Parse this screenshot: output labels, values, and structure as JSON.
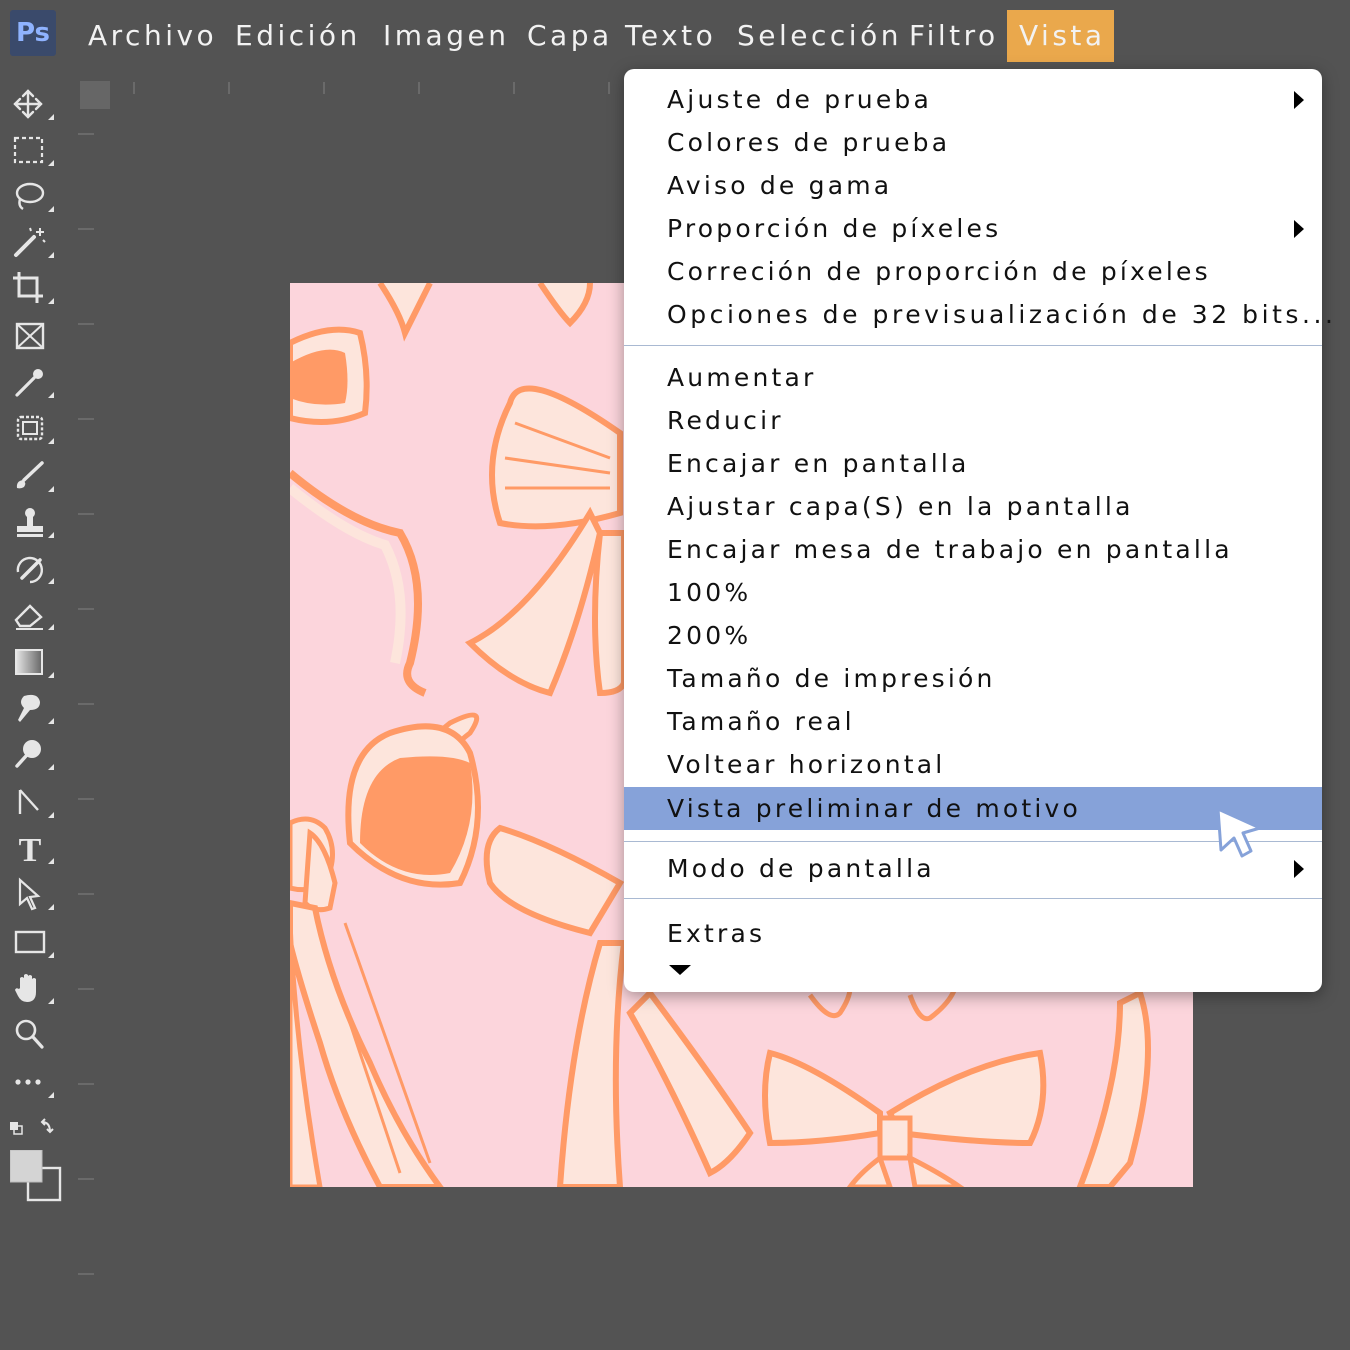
{
  "app": {
    "logo_text": "Ps"
  },
  "menubar": {
    "items": [
      {
        "label": "Archivo"
      },
      {
        "label": "Edición"
      },
      {
        "label": "Imagen"
      },
      {
        "label": "Capa"
      },
      {
        "label": "Texto"
      },
      {
        "label": "Selección"
      },
      {
        "label": "Filtro"
      },
      {
        "label": "Vista"
      }
    ],
    "active_item": "Vista",
    "active_color": "#eaa84c"
  },
  "toolbar": {
    "tools": [
      {
        "icon": "move-icon"
      },
      {
        "icon": "marquee-icon"
      },
      {
        "icon": "lasso-icon"
      },
      {
        "icon": "magic-wand-icon"
      },
      {
        "icon": "crop-icon"
      },
      {
        "icon": "frame-icon"
      },
      {
        "icon": "eyedropper-icon"
      },
      {
        "icon": "spot-healing-icon"
      },
      {
        "icon": "brush-icon"
      },
      {
        "icon": "stamp-icon"
      },
      {
        "icon": "history-brush-icon"
      },
      {
        "icon": "eraser-icon"
      },
      {
        "icon": "gradient-icon"
      },
      {
        "icon": "smudge-icon"
      },
      {
        "icon": "dodge-icon"
      },
      {
        "icon": "pen-icon"
      },
      {
        "icon": "type-icon"
      },
      {
        "icon": "path-selection-icon"
      },
      {
        "icon": "rectangle-icon"
      },
      {
        "icon": "hand-icon"
      },
      {
        "icon": "zoom-icon"
      },
      {
        "icon": "more-tools-icon"
      }
    ]
  },
  "dropdown": {
    "group1": [
      {
        "label": "Ajuste de prueba",
        "submenu": true
      },
      {
        "label": "Colores de prueba",
        "submenu": false
      },
      {
        "label": "Aviso de gama",
        "submenu": false
      },
      {
        "label": "Proporción de píxeles",
        "submenu": true
      },
      {
        "label": "Correción de proporción de píxeles",
        "submenu": false
      },
      {
        "label": "Opciones de previsualización de 32 bits...",
        "submenu": false
      }
    ],
    "group2": [
      {
        "label": "Aumentar"
      },
      {
        "label": "Reducir"
      },
      {
        "label": "Encajar en pantalla"
      },
      {
        "label": "Ajustar capa(S) en la pantalla"
      },
      {
        "label": "Encajar mesa de trabajo en pantalla"
      },
      {
        "label": "100%"
      },
      {
        "label": "200%"
      },
      {
        "label": "Tamaño de impresión"
      },
      {
        "label": "Tamaño real"
      },
      {
        "label": "Voltear horizontal"
      },
      {
        "label": "Vista preliminar de motivo",
        "highlighted": true
      }
    ],
    "group3": [
      {
        "label": "Modo de pantalla",
        "submenu": true
      }
    ],
    "group4": [
      {
        "label": "Extras"
      }
    ],
    "highlight_color": "#86a2d9"
  },
  "document": {
    "background_color": "#fcd5dc",
    "pattern_colors": [
      "#ff9a66",
      "#fde5dc",
      "#fcd5dc"
    ]
  }
}
